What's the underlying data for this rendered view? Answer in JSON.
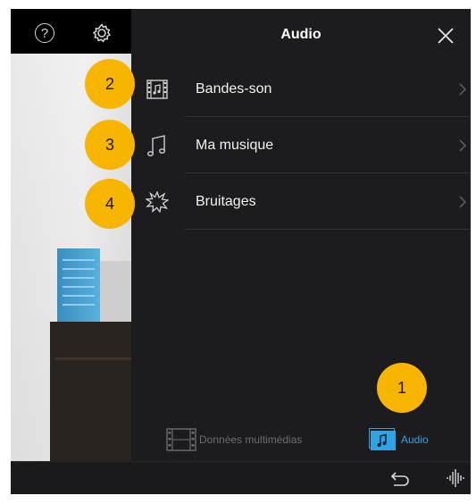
{
  "toolbar": {
    "help_icon": "question-circle-icon",
    "settings_icon": "gear-icon"
  },
  "panel": {
    "title": "Audio",
    "close_icon": "close-icon",
    "items": [
      {
        "label": "Bandes-son",
        "icon": "film-music-icon"
      },
      {
        "label": "Ma musique",
        "icon": "music-note-icon"
      },
      {
        "label": "Bruitages",
        "icon": "starburst-icon"
      }
    ],
    "tabs": [
      {
        "label": "Données multimédias",
        "icon": "film-strip-icon",
        "active": false
      },
      {
        "label": "Audio",
        "icon": "audio-icon",
        "active": true
      }
    ]
  },
  "bottom_bar": {
    "undo_icon": "undo-icon",
    "waveform_icon": "waveform-icon"
  },
  "callouts": [
    "1",
    "2",
    "3",
    "4"
  ],
  "colors": {
    "accent": "#2ea3e6",
    "badge": "#f7b500",
    "panel_bg": "#1c1c1e"
  }
}
